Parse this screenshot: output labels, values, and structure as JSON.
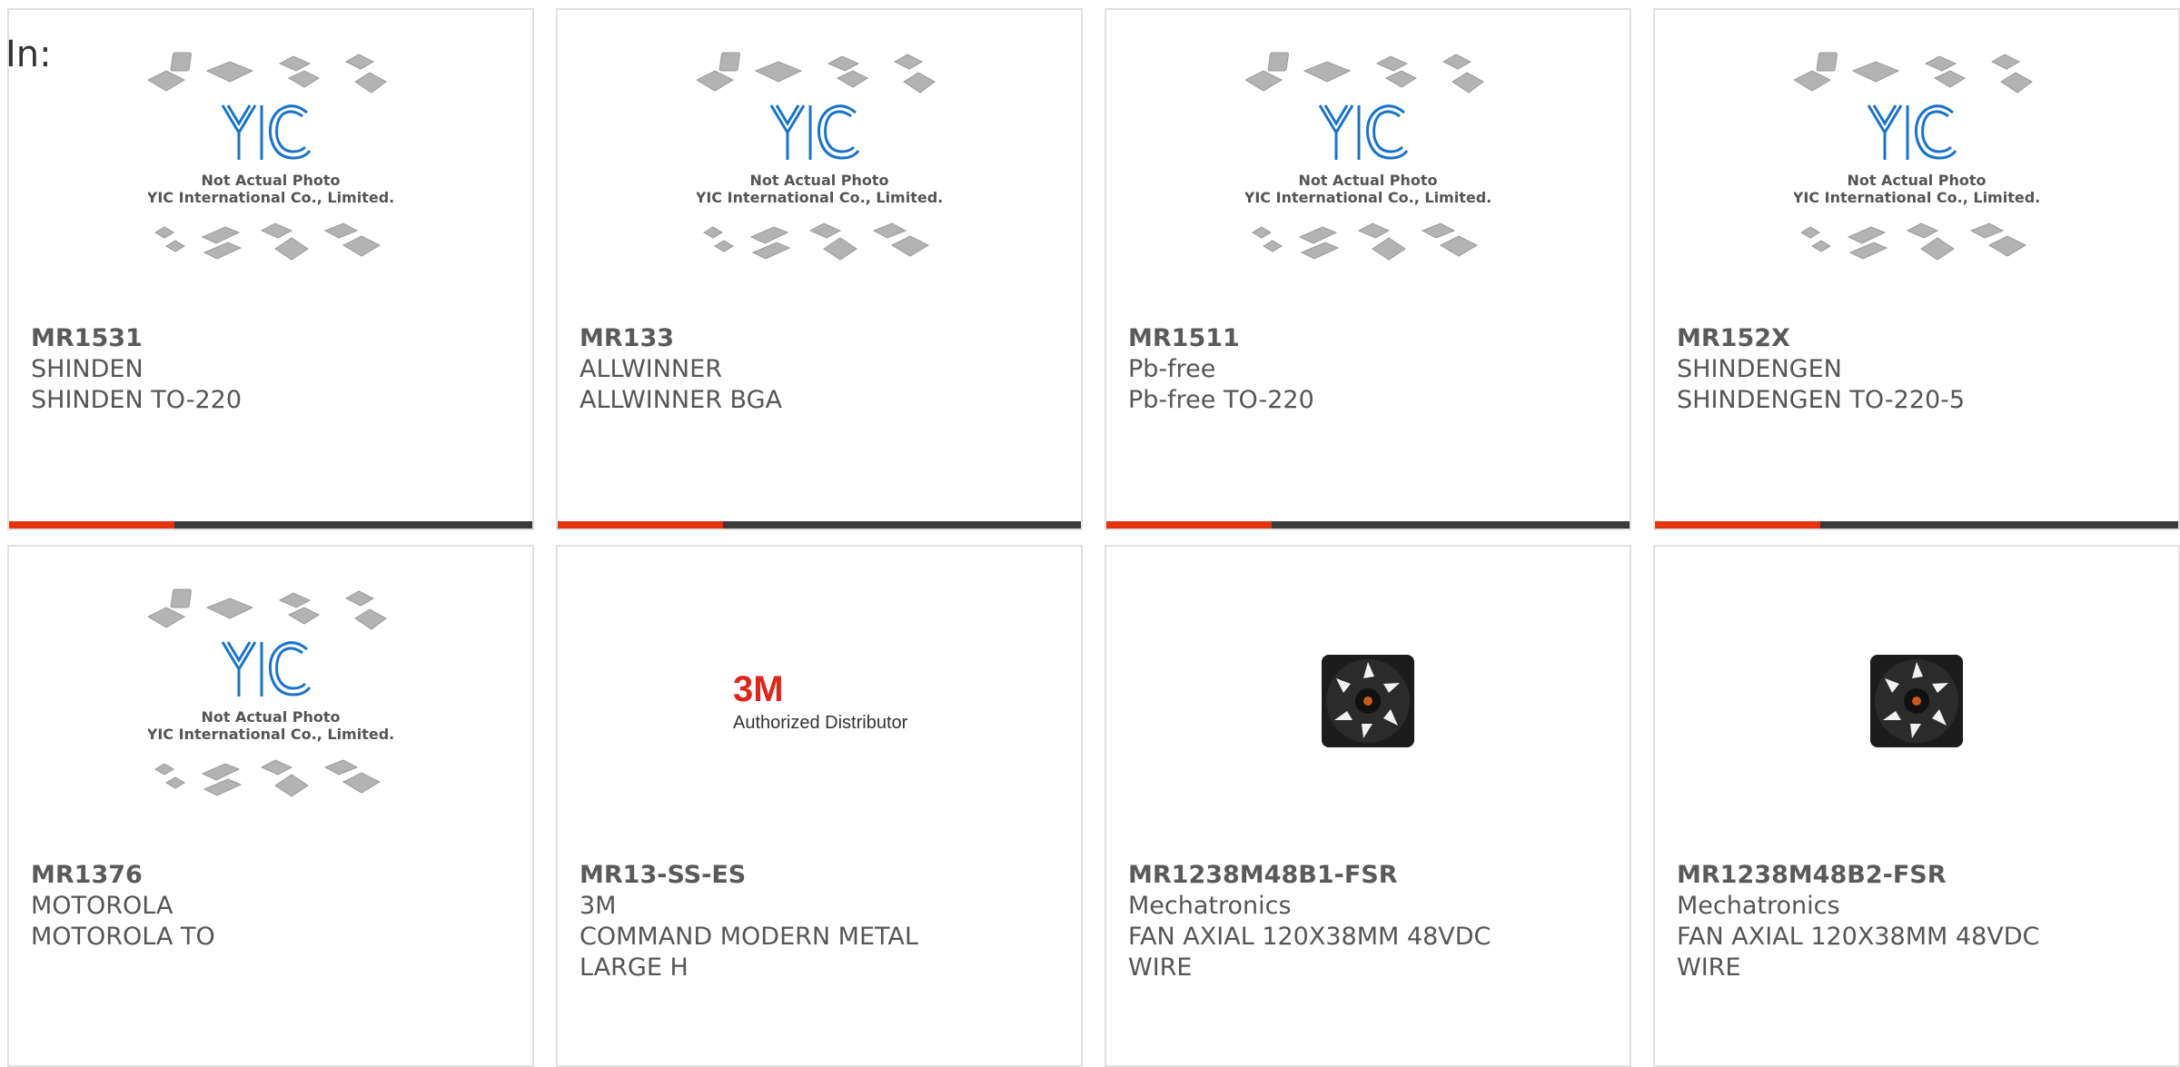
{
  "header": {
    "in_label": "In:"
  },
  "placeholder": {
    "logo": "YIC",
    "line1": "Not Actual Photo",
    "line2": "YIC International Co., Limited."
  },
  "badge_3m": {
    "logo": "3M",
    "text": "Authorized Distributor"
  },
  "colors": {
    "accent": "#e5330f",
    "bar": "#3b3b3b",
    "logo_blue": "#1a73c7",
    "brand_red": "#e0261b"
  },
  "products": [
    {
      "part": "MR1531",
      "mfr": "SHINDEN",
      "desc": "SHINDEN TO-220",
      "desc2": "",
      "image": "placeholder",
      "accent_bar": true
    },
    {
      "part": "MR133",
      "mfr": "ALLWINNER",
      "desc": "ALLWINNER BGA",
      "desc2": "",
      "image": "placeholder",
      "accent_bar": true
    },
    {
      "part": "MR1511",
      "mfr": "Pb-free",
      "desc": "Pb-free TO-220",
      "desc2": "",
      "image": "placeholder",
      "accent_bar": true
    },
    {
      "part": "MR152X",
      "mfr": "SHINDENGEN",
      "desc": "SHINDENGEN TO-220-5",
      "desc2": "",
      "image": "placeholder",
      "accent_bar": true
    },
    {
      "part": "MR1376",
      "mfr": "MOTOROLA",
      "desc": "MOTOROLA TO",
      "desc2": "",
      "image": "placeholder",
      "accent_bar": false
    },
    {
      "part": "MR13-SS-ES",
      "mfr": "3M",
      "desc": "COMMAND MODERN METAL",
      "desc2": "LARGE H",
      "image": "3m",
      "accent_bar": false
    },
    {
      "part": "MR1238M48B1-FSR",
      "mfr": "Mechatronics",
      "desc": "FAN AXIAL 120X38MM 48VDC",
      "desc2": "WIRE",
      "image": "fan",
      "accent_bar": false
    },
    {
      "part": "MR1238M48B2-FSR",
      "mfr": "Mechatronics",
      "desc": "FAN AXIAL 120X38MM 48VDC",
      "desc2": "WIRE",
      "image": "fan",
      "accent_bar": false
    }
  ]
}
